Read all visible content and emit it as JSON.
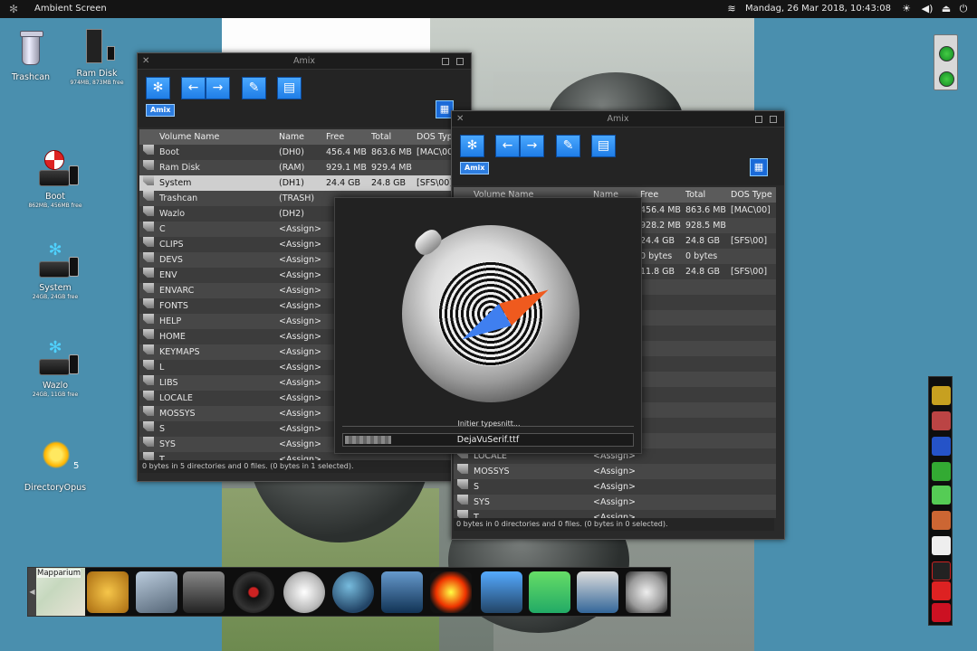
{
  "menubar": {
    "title": "Ambient Screen",
    "clock": "Mandag, 26 Mar 2018, 10:43:08",
    "tray_icons": [
      "wifi-icon",
      "brightness-icon",
      "volume-icon",
      "eject-icon",
      "power-icon"
    ]
  },
  "desktop_icons": [
    {
      "label": "Trashcan",
      "sub": ""
    },
    {
      "label": "Ram Disk",
      "sub": "974MB, 873MB free"
    },
    {
      "label": "Boot",
      "sub": "862MB, 456MB free"
    },
    {
      "label": "System",
      "sub": "24GB, 24GB free"
    },
    {
      "label": "Wazlo",
      "sub": "24GB, 11GB free"
    },
    {
      "label": "DirectoryOpus",
      "sub": ""
    }
  ],
  "window1": {
    "title": "Amix",
    "badge": "Amix",
    "columns": {
      "volume": "Volume Name",
      "name": "Name",
      "free": "Free",
      "total": "Total",
      "dostype": "DOS Type"
    },
    "rows": [
      {
        "volume": "Boot",
        "name": "(DH0)",
        "free": "456.4 MB",
        "total": "863.6 MB",
        "dostype": "[MAC\\00]"
      },
      {
        "volume": "Ram Disk",
        "name": "(RAM)",
        "free": "929.1 MB",
        "total": "929.4 MB",
        "dostype": ""
      },
      {
        "volume": "System",
        "name": "(DH1)",
        "free": "24.4 GB",
        "total": "24.8 GB",
        "dostype": "[SFS\\00]"
      },
      {
        "volume": "Trashcan",
        "name": "(TRASH)",
        "free": "",
        "total": "",
        "dostype": ""
      },
      {
        "volume": "Wazlo",
        "name": "(DH2)",
        "free": "",
        "total": "",
        "dostype": ""
      },
      {
        "volume": "C",
        "name": "<Assign>",
        "free": "",
        "total": "",
        "dostype": ""
      },
      {
        "volume": "CLIPS",
        "name": "<Assign>",
        "free": "",
        "total": "",
        "dostype": ""
      },
      {
        "volume": "DEVS",
        "name": "<Assign>",
        "free": "",
        "total": "",
        "dostype": ""
      },
      {
        "volume": "ENV",
        "name": "<Assign>",
        "free": "",
        "total": "",
        "dostype": ""
      },
      {
        "volume": "ENVARC",
        "name": "<Assign>",
        "free": "",
        "total": "",
        "dostype": ""
      },
      {
        "volume": "FONTS",
        "name": "<Assign>",
        "free": "",
        "total": "",
        "dostype": ""
      },
      {
        "volume": "HELP",
        "name": "<Assign>",
        "free": "",
        "total": "",
        "dostype": ""
      },
      {
        "volume": "HOME",
        "name": "<Assign>",
        "free": "",
        "total": "",
        "dostype": ""
      },
      {
        "volume": "KEYMAPS",
        "name": "<Assign>",
        "free": "",
        "total": "",
        "dostype": ""
      },
      {
        "volume": "L",
        "name": "<Assign>",
        "free": "",
        "total": "",
        "dostype": ""
      },
      {
        "volume": "LIBS",
        "name": "<Assign>",
        "free": "",
        "total": "",
        "dostype": ""
      },
      {
        "volume": "LOCALE",
        "name": "<Assign>",
        "free": "",
        "total": "",
        "dostype": ""
      },
      {
        "volume": "MOSSYS",
        "name": "<Assign>",
        "free": "",
        "total": "",
        "dostype": ""
      },
      {
        "volume": "S",
        "name": "<Assign>",
        "free": "",
        "total": "",
        "dostype": ""
      },
      {
        "volume": "SYS",
        "name": "<Assign>",
        "free": "",
        "total": "",
        "dostype": ""
      },
      {
        "volume": "T",
        "name": "<Assign>",
        "free": "",
        "total": "",
        "dostype": ""
      }
    ],
    "status": "0 bytes in 5 directories and 0 files. (0 bytes in 1 selected)."
  },
  "window2": {
    "title": "Amix",
    "badge": "Amix",
    "columns": {
      "volume": "Volume Name",
      "name": "Name",
      "free": "Free",
      "total": "Total",
      "dostype": "DOS Type"
    },
    "rows": [
      {
        "volume": "",
        "name": "",
        "free": "456.4 MB",
        "total": "863.6 MB",
        "dostype": "[MAC\\00]"
      },
      {
        "volume": "",
        "name": "",
        "free": "928.2 MB",
        "total": "928.5 MB",
        "dostype": ""
      },
      {
        "volume": "",
        "name": "",
        "free": "24.4 GB",
        "total": "24.8 GB",
        "dostype": "[SFS\\00]"
      },
      {
        "volume": "",
        "name": "",
        "free": "0 bytes",
        "total": "0 bytes",
        "dostype": ""
      },
      {
        "volume": "",
        "name": "",
        "free": "11.8 GB",
        "total": "24.8 GB",
        "dostype": "[SFS\\00]"
      },
      {
        "volume": "",
        "name": "",
        "free": "",
        "total": "",
        "dostype": ""
      },
      {
        "volume": "",
        "name": "",
        "free": "",
        "total": "",
        "dostype": ""
      },
      {
        "volume": "",
        "name": "",
        "free": "",
        "total": "",
        "dostype": ""
      },
      {
        "volume": "",
        "name": "",
        "free": "",
        "total": "",
        "dostype": ""
      },
      {
        "volume": "",
        "name": "",
        "free": "",
        "total": "",
        "dostype": ""
      },
      {
        "volume": "",
        "name": "",
        "free": "",
        "total": "",
        "dostype": ""
      },
      {
        "volume": "",
        "name": "",
        "free": "",
        "total": "",
        "dostype": ""
      },
      {
        "volume": "",
        "name": "",
        "free": "",
        "total": "",
        "dostype": ""
      },
      {
        "volume": "",
        "name": "",
        "free": "",
        "total": "",
        "dostype": ""
      },
      {
        "volume": "",
        "name": "",
        "free": "",
        "total": "",
        "dostype": ""
      },
      {
        "volume": "",
        "name": "",
        "free": "",
        "total": "",
        "dostype": ""
      },
      {
        "volume": "LOCALE",
        "name": "<Assign>",
        "free": "",
        "total": "",
        "dostype": ""
      },
      {
        "volume": "MOSSYS",
        "name": "<Assign>",
        "free": "",
        "total": "",
        "dostype": ""
      },
      {
        "volume": "S",
        "name": "<Assign>",
        "free": "",
        "total": "",
        "dostype": ""
      },
      {
        "volume": "SYS",
        "name": "<Assign>",
        "free": "",
        "total": "",
        "dostype": ""
      },
      {
        "volume": "T",
        "name": "<Assign>",
        "free": "",
        "total": "",
        "dostype": ""
      }
    ],
    "status": "0 bytes in 0 directories and 0 files. (0 bytes in 0 selected)."
  },
  "splash": {
    "message": "Initier typesnitt...",
    "progress_text": "DejaVuSerif.ttf",
    "progress_fraction": 0.16
  },
  "dock": {
    "map_label": "Mapparium",
    "icons": [
      "theater-mask-icon",
      "scanner-icon",
      "movie-clapper-icon",
      "vinyl-record-icon",
      "compass-icon",
      "globe-icon",
      "monitor-icon",
      "fireworks-icon",
      "upload-drive-icon",
      "download-drive-icon",
      "document-edit-icon",
      "magnifier-icon"
    ]
  },
  "right_dock": {
    "icons": [
      "app-icon-1",
      "app-icon-2",
      "sdl-icon",
      "app-icon-4",
      "frog-icon",
      "app-icon-6",
      "diamond-icon",
      "ds-icon",
      "red-icon",
      "check-icon"
    ]
  }
}
